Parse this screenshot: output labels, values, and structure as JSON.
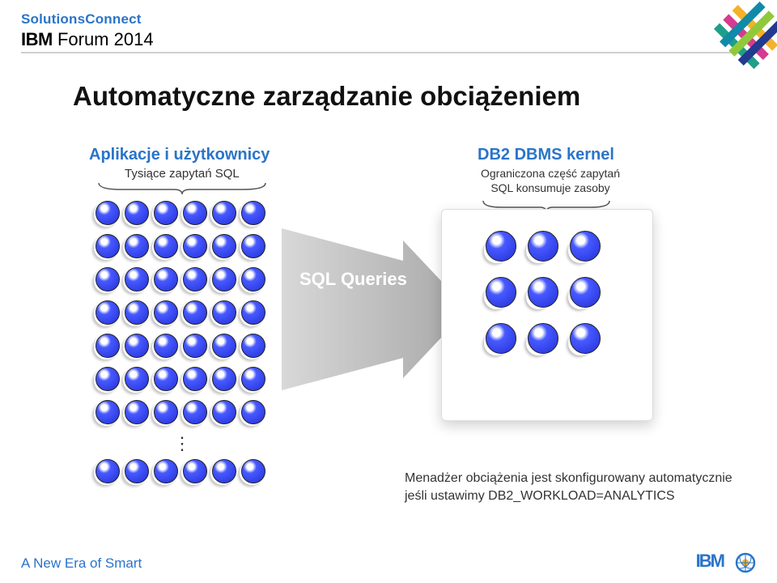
{
  "header": {
    "solutions": "SolutionsConnect",
    "forum_ibm": "IBM",
    "forum_rest": " Forum 2014"
  },
  "title": "Automatyczne zarządzanie obciążeniem",
  "left": {
    "heading": "Aplikacje i użytkownicy",
    "sub": "Tysiące zapytań SQL"
  },
  "right": {
    "heading": "DB2 DBMS kernel",
    "sub": "Ograniczona część zapytań SQL konsumuje zasoby"
  },
  "arrow_label": "SQL Queries",
  "note": "Menadżer obciążenia jest skonfigurowany automatycznie jeśli ustawimy DB2_WORKLOAD=ANALYTICS",
  "footer": "A New Era of Smart",
  "ibm": "IBM"
}
